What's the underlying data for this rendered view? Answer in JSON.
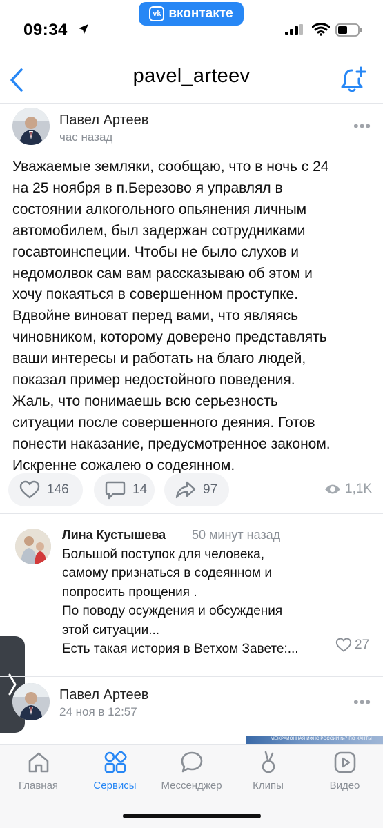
{
  "status_bar": {
    "time": "09:34",
    "app_pill": "вконтакте",
    "app_logo": "vk"
  },
  "header": {
    "title": "pavel_arteev"
  },
  "post": {
    "author": "Павел Артеев",
    "time": "час назад",
    "text_lines": [
      "Уважаемые земляки, сообщаю, что в ночь с 24",
      "на 25 ноября в п.Березово я управлял в",
      "состоянии алкогольного опьянения личным",
      "автомобилем, был задержан сотрудниками",
      "госавтоинспеции. Чтобы не было слухов и",
      "недомолвок сам вам рассказываю об этом и",
      "хочу покаяться в совершенном проступке.",
      "Вдвойне виноват перед вами, что являясь",
      "чиновником, которому доверено представлять",
      "ваши интересы и работать на благо людей,",
      "показал пример недостойного поведения.",
      "Жаль, что понимаешь всю серьезность",
      "ситуации после совершенного деяния. Готов",
      "понести наказание, предусмотренное законом.",
      "Искренне сожалею о содеянном."
    ],
    "likes": "146",
    "comments": "14",
    "shares": "97",
    "views": "1,1K"
  },
  "comment": {
    "author": "Лина Кустышева",
    "time": "50 минут назад",
    "text_lines": [
      "Большой поступок для человека,",
      "самому признаться в содеянном и",
      "попросить прощения .",
      "По поводу осуждения и обсуждения",
      "этой ситуации...",
      "Есть такая история в Ветхом Завете:..."
    ],
    "likes": "27"
  },
  "post2": {
    "author": "Павел Артеев",
    "time": "24 ноя в 12:57",
    "image_caption": "МЕЖРАЙОННАЯ ИФНС РОССИИ №7 ПО ХАНТЫ"
  },
  "tabs": [
    {
      "label": "Главная",
      "icon": "home-icon"
    },
    {
      "label": "Сервисы",
      "icon": "services-icon"
    },
    {
      "label": "Мессенджер",
      "icon": "messenger-icon"
    },
    {
      "label": "Клипы",
      "icon": "clips-icon"
    },
    {
      "label": "Видео",
      "icon": "video-icon"
    }
  ],
  "colors": {
    "accent": "#2787f5",
    "muted": "#8a8f96",
    "pill_bg": "#f2f3f5"
  }
}
